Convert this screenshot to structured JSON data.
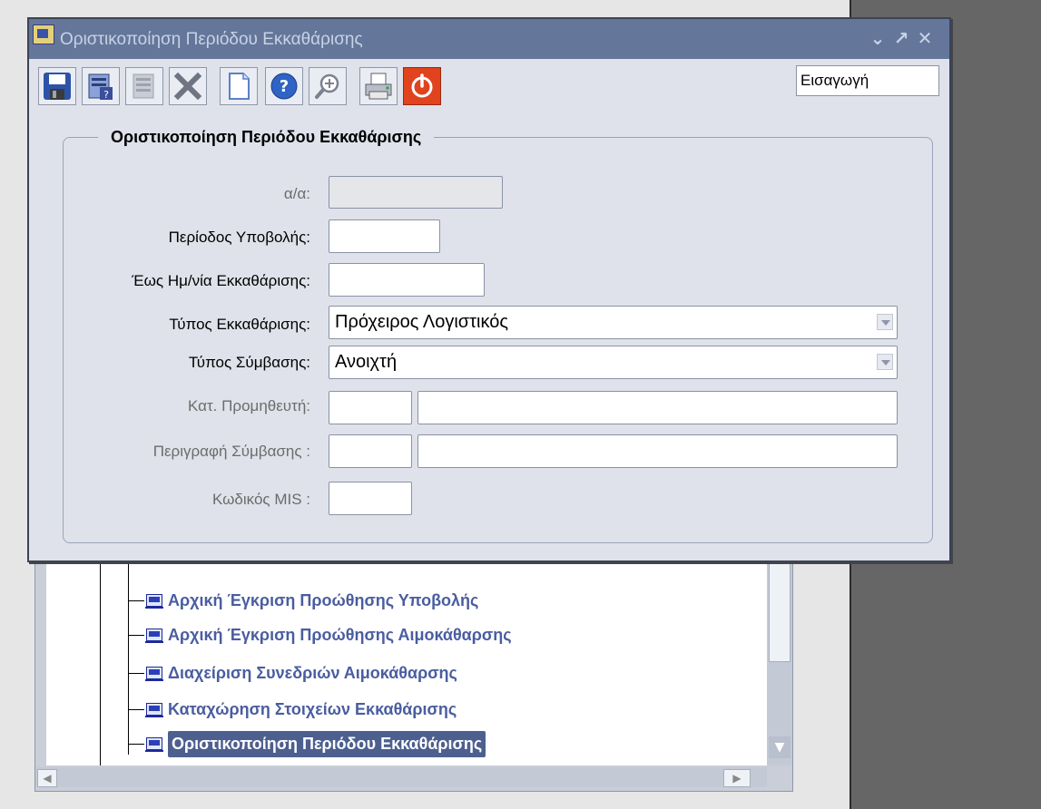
{
  "window": {
    "title": "Οριστικοποίηση Περιόδου Εκκαθάρισης",
    "mode": "Εισαγωγή"
  },
  "toolbar": {
    "buttons": [
      {
        "icon": "save-icon"
      },
      {
        "icon": "clear-form-icon"
      },
      {
        "icon": "clear-record-icon"
      },
      {
        "icon": "delete-icon"
      },
      {
        "icon": "new-record-icon"
      },
      {
        "icon": "help-icon"
      },
      {
        "icon": "zoom-icon"
      },
      {
        "icon": "print-icon"
      },
      {
        "icon": "exit-icon"
      }
    ]
  },
  "form": {
    "group_title": "Οριστικοποίηση Περιόδου Εκκαθάρισης",
    "fields": {
      "aa_label": "α/α:",
      "period_label": "Περίοδος Υποβολής:",
      "until_date_label": "Έως Ημ/νία Εκκαθάρισης:",
      "clearance_type_label": "Τύπος Εκκαθάρισης:",
      "clearance_type_value": "Πρόχειρος Λογιστικός",
      "contract_type_label": "Τύπος Σύμβασης:",
      "contract_type_value": "Ανοιχτή",
      "supplier_label": "Κατ. Προμηθευτή:",
      "contract_desc_label": "Περιγραφή Σύμβασης :",
      "mis_code_label": "Κωδικός MIS :"
    }
  },
  "tree": {
    "items": [
      {
        "label": "Αρχική Έγκριση Προώθησης Υποβολής",
        "selected": false
      },
      {
        "label": "Αρχική Έγκριση Προώθησης Αιμοκάθαρσης",
        "selected": false
      },
      {
        "label": "Διαχείριση Συνεδριών Αιμοκάθαρσης",
        "selected": false
      },
      {
        "label": "Καταχώρηση Στοιχείων Εκκαθάρισης",
        "selected": false
      },
      {
        "label": "Οριστικοποίηση Περιόδου Εκκαθάρισης",
        "selected": true
      }
    ]
  },
  "colors": {
    "titlebar": "#64779a",
    "selected_item": "#4d5f8e",
    "tree_text": "#4a5da0",
    "stop_button": "#e0431e"
  }
}
